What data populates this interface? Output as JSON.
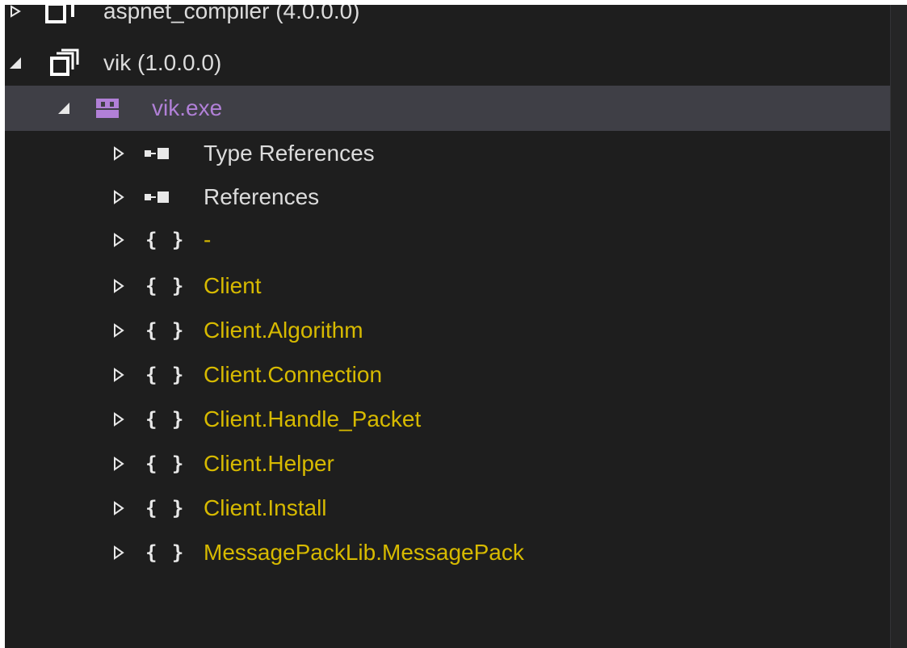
{
  "tree": {
    "assembly_aspnet": {
      "label": "aspnet_compiler (4.0.0.0)",
      "expanded": false,
      "icon": "assembly-icon"
    },
    "assembly_vik": {
      "label": "vik (1.0.0.0)",
      "expanded": true,
      "icon": "assembly-icon"
    },
    "module_vik_exe": {
      "label": "vik.exe",
      "expanded": true,
      "selected": true,
      "icon": "module-icon",
      "color": "#b180d7"
    },
    "children": [
      {
        "label": "Type References",
        "icon": "references-icon"
      },
      {
        "label": "References",
        "icon": "references-icon"
      },
      {
        "label": "-",
        "icon": "namespace-icon"
      },
      {
        "label": "Client",
        "icon": "namespace-icon"
      },
      {
        "label": "Client.Algorithm",
        "icon": "namespace-icon"
      },
      {
        "label": "Client.Connection",
        "icon": "namespace-icon"
      },
      {
        "label": "Client.Handle_Packet",
        "icon": "namespace-icon"
      },
      {
        "label": "Client.Helper",
        "icon": "namespace-icon"
      },
      {
        "label": "Client.Install",
        "icon": "namespace-icon"
      },
      {
        "label": "MessagePackLib.MessagePack",
        "icon": "namespace-icon"
      }
    ],
    "braces_glyph": "{ }"
  },
  "colors": {
    "background": "#1e1e1e",
    "selection": "#3f3f46",
    "namespace_text": "#d7ba00",
    "default_text": "#dcdcdc",
    "module_text": "#b180d7"
  }
}
